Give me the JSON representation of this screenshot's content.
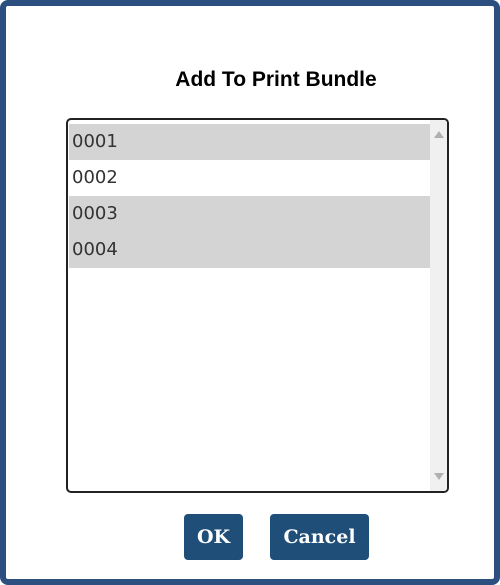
{
  "dialog": {
    "title": "Add To Print Bundle",
    "items": [
      {
        "label": "0001",
        "selected": true
      },
      {
        "label": "0002",
        "selected": false
      },
      {
        "label": "0003",
        "selected": true
      },
      {
        "label": "0004",
        "selected": true
      }
    ],
    "ok_label": "OK",
    "cancel_label": "Cancel"
  },
  "colors": {
    "frame": "#2b4f7f",
    "button": "#1f4e79",
    "selected_row": "#d4d4d4"
  },
  "icons": {
    "scroll_up": "triangle-up",
    "scroll_down": "triangle-down"
  }
}
